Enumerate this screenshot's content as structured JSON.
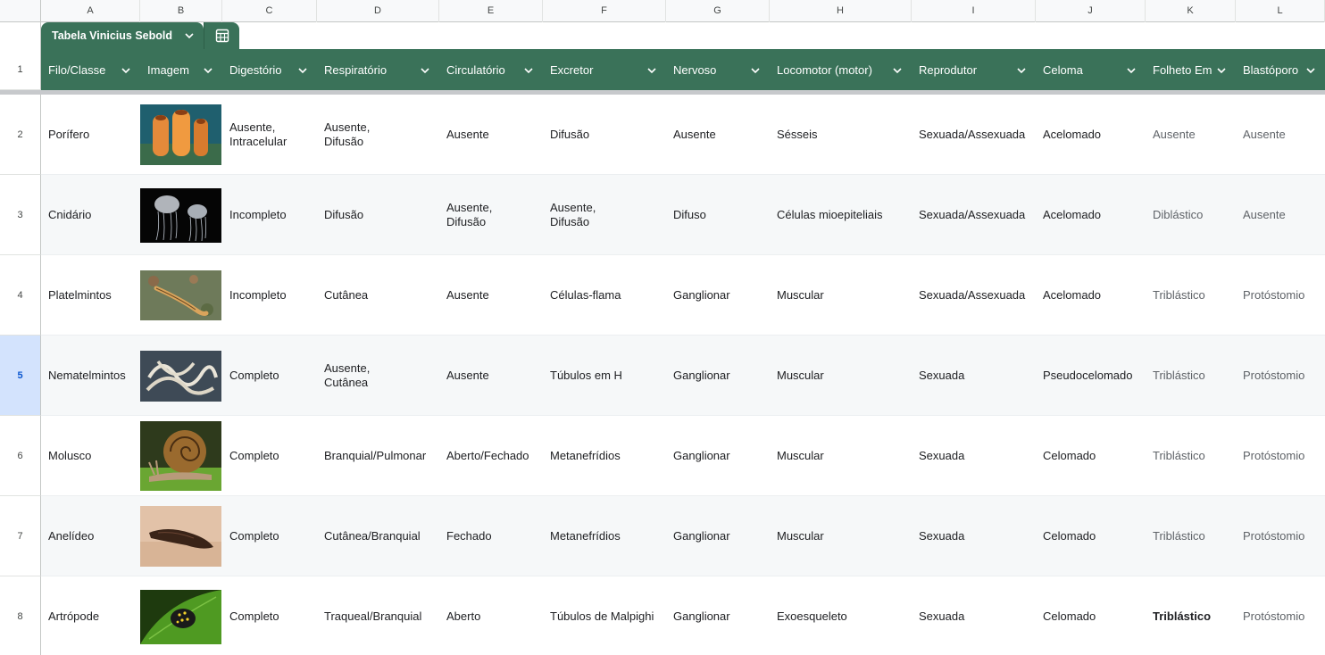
{
  "column_letters": [
    "A",
    "B",
    "C",
    "D",
    "E",
    "F",
    "G",
    "H",
    "I",
    "J",
    "K",
    "L"
  ],
  "table_name": "Tabela Vinicius Sebold",
  "header_row_number": "1",
  "headers": [
    "Filo/Classe",
    "Imagem",
    "Digestório",
    "Respiratório",
    "Circulatório",
    "Excretor",
    "Nervoso",
    "Locomotor (motor)",
    "Reprodutor",
    "Celoma",
    "Folheto Em",
    "Blastóporo"
  ],
  "selected_row": "5",
  "rows": [
    {
      "num": "2",
      "filo": "Porífero",
      "image": "sponge-photo",
      "digestorio": [
        "Ausente,",
        "Intracelular"
      ],
      "respiratorio": [
        "Ausente,",
        "Difusão"
      ],
      "circulatorio": [
        "Ausente"
      ],
      "excretor": [
        "Difusão"
      ],
      "nervoso": "Ausente",
      "locomotor": "Sésseis",
      "reprodutor": "Sexuada/Assexuada",
      "celoma": "Acelomado",
      "folheto": "Ausente",
      "blastoporo": "Ausente"
    },
    {
      "num": "3",
      "filo": "Cnidário",
      "image": "jellyfish-photo",
      "digestorio": [
        "Incompleto"
      ],
      "respiratorio": [
        "Difusão"
      ],
      "circulatorio": [
        "Ausente,",
        "Difusão"
      ],
      "excretor": [
        "Ausente,",
        "Difusão"
      ],
      "nervoso": "Difuso",
      "locomotor": "Células mioepiteliais",
      "reprodutor": "Sexuada/Assexuada",
      "celoma": "Acelomado",
      "folheto": "Diblástico",
      "blastoporo": "Ausente"
    },
    {
      "num": "4",
      "filo": "Platelmintos",
      "image": "flatworm-photo",
      "digestorio": [
        "Incompleto"
      ],
      "respiratorio": [
        "Cutânea"
      ],
      "circulatorio": [
        "Ausente"
      ],
      "excretor": [
        "Células-flama"
      ],
      "nervoso": "Ganglionar",
      "locomotor": "Muscular",
      "reprodutor": "Sexuada/Assexuada",
      "celoma": "Acelomado",
      "folheto": "Triblástico",
      "blastoporo": "Protóstomio"
    },
    {
      "num": "5",
      "filo": "Nematelmintos",
      "image": "roundworm-photo",
      "digestorio": [
        "Completo"
      ],
      "respiratorio": [
        "Ausente,",
        "Cutânea"
      ],
      "circulatorio": [
        "Ausente"
      ],
      "excretor": [
        "Túbulos em H"
      ],
      "nervoso": "Ganglionar",
      "locomotor": "Muscular",
      "reprodutor": "Sexuada",
      "celoma": "Pseudocelomado",
      "folheto": "Triblástico",
      "blastoporo": "Protóstomio"
    },
    {
      "num": "6",
      "filo": "Molusco",
      "image": "snail-photo",
      "digestorio": [
        "Completo"
      ],
      "respiratorio": [
        "Branquial/Pulmonar"
      ],
      "circulatorio": [
        "Aberto/Fechado"
      ],
      "excretor": [
        "Metanefrídios"
      ],
      "nervoso": "Ganglionar",
      "locomotor": "Muscular",
      "reprodutor": "Sexuada",
      "celoma": "Celomado",
      "folheto": "Triblástico",
      "blastoporo": "Protóstomio"
    },
    {
      "num": "7",
      "filo": "Anelídeo",
      "image": "leech-photo",
      "digestorio": [
        "Completo"
      ],
      "respiratorio": [
        "Cutânea/Branquial"
      ],
      "circulatorio": [
        "Fechado"
      ],
      "excretor": [
        "Metanefrídios"
      ],
      "nervoso": "Ganglionar",
      "locomotor": "Muscular",
      "reprodutor": "Sexuada",
      "celoma": "Celomado",
      "folheto": "Triblástico",
      "blastoporo": "Protóstomio"
    },
    {
      "num": "8",
      "filo": "Artrópode",
      "image": "beetle-photo",
      "digestorio": [
        "Completo"
      ],
      "respiratorio": [
        "Traqueal/Branquial"
      ],
      "circulatorio": [
        "Aberto"
      ],
      "excretor": [
        "Túbulos de Malpighi"
      ],
      "nervoso": "Ganglionar",
      "locomotor": "Exoesqueleto",
      "reprodutor": "Sexuada",
      "celoma": "Celomado",
      "folheto": "Triblástico",
      "blastoporo": "Protóstomio"
    }
  ],
  "colors": {
    "header_green": "#3a7259",
    "selected_row_bg": "#d3e3fd",
    "alt_row_bg": "#f6f8f9",
    "muted_text": "#5f6368"
  },
  "icons": {
    "dropdown": "chevron-down-icon",
    "table_view": "table-grid-icon"
  }
}
